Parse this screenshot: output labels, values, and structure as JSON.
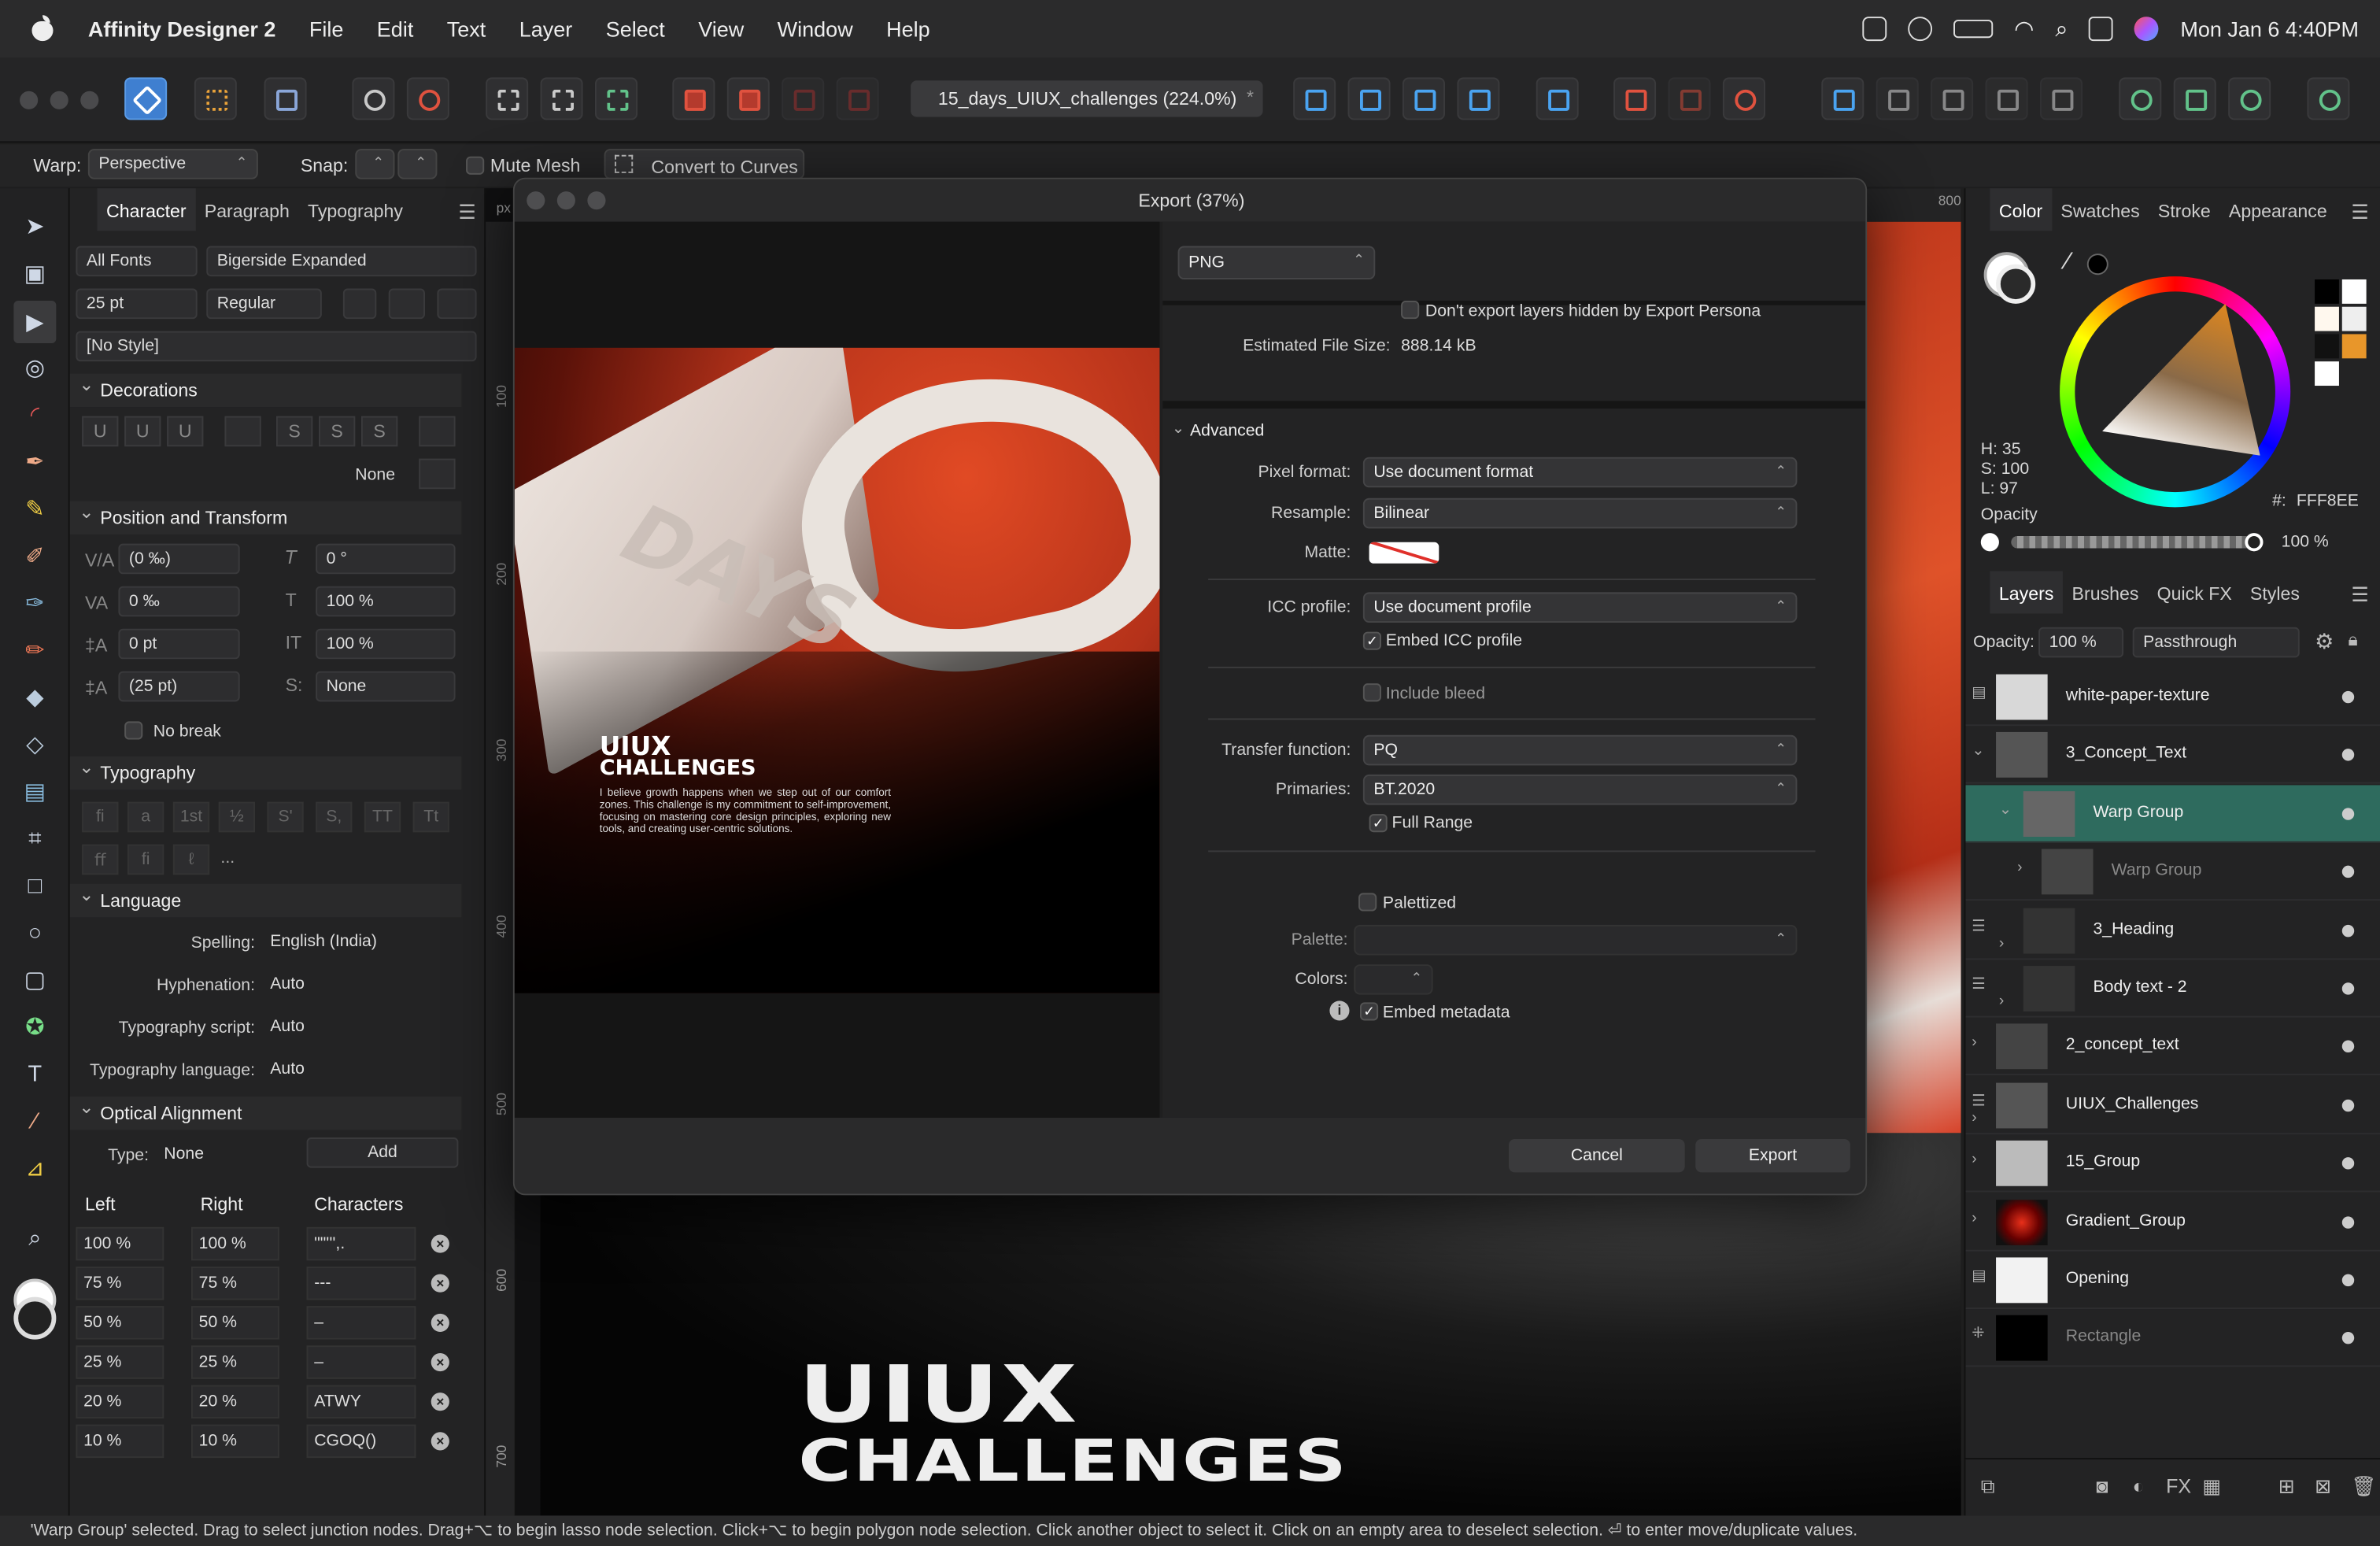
{
  "menubar": {
    "app_name": "Affinity Designer 2",
    "items": [
      "File",
      "Edit",
      "Text",
      "Layer",
      "Select",
      "View",
      "Window",
      "Help"
    ],
    "datetime": "Mon Jan 6  4:40PM"
  },
  "toolbar": {
    "doc_tab": "15_days_UIUX_challenges  (224.0%)",
    "doc_tab_star": "*"
  },
  "context": {
    "warp_label": "Warp:",
    "warp_value": "Perspective",
    "snap_label": "Snap:",
    "mute_mesh": "Mute Mesh",
    "convert": "Convert to Curves"
  },
  "character": {
    "tabs": [
      "Character",
      "Paragraph",
      "Typography"
    ],
    "font_collection": "All Fonts",
    "font_family": "Bigerside Expanded",
    "font_size": "25 pt",
    "font_weight": "Regular",
    "style": "[No Style]",
    "decorations_title": "Decorations",
    "deco_none": "None",
    "pos_title": "Position and Transform",
    "tracking": "(0 ‰)",
    "shear": "0 °",
    "kerning": "0 ‰",
    "hscale": "100 %",
    "baseline": "0 pt",
    "vscale": "100 %",
    "leading": "(25 pt)",
    "shift": "None",
    "nobreak": "No break",
    "typography_title": "Typography",
    "typo_buttons": [
      "fi",
      "a",
      "1st",
      "½",
      "S'",
      "S,",
      "TT",
      "Tt",
      "ﬀ",
      "fi",
      "ℓ",
      "..."
    ],
    "language_title": "Language",
    "spelling_label": "Spelling:",
    "spelling": "English (India)",
    "hyph_label": "Hyphenation:",
    "hyph": "Auto",
    "script_label": "Typography script:",
    "script": "Auto",
    "lang_label": "Typography language:",
    "lang": "Auto",
    "optical_title": "Optical Alignment",
    "type_label": "Type:",
    "type_value": "None",
    "add": "Add",
    "opt_headers": [
      "Left",
      "Right",
      "Characters"
    ],
    "opt_rows": [
      {
        "left": "100 %",
        "right": "100 %",
        "chars": "\"\"''',."
      },
      {
        "left": "75 %",
        "right": "75 %",
        "chars": "---"
      },
      {
        "left": "50 %",
        "right": "50 %",
        "chars": "–"
      },
      {
        "left": "25 %",
        "right": "25 %",
        "chars": "–"
      },
      {
        "left": "20 %",
        "right": "20 %",
        "chars": "ATWY"
      },
      {
        "left": "10 %",
        "right": "10 %",
        "chars": "CGOQ()"
      }
    ]
  },
  "ruler": {
    "v": [
      "100",
      "200",
      "300",
      "400",
      "500",
      "600",
      "700"
    ],
    "h": "800",
    "px": "px"
  },
  "canvas": {
    "big_line1": "UIUX",
    "big_line2": "CHALLENGES"
  },
  "dialog": {
    "title": "Export (37%)",
    "format": "PNG",
    "hidden_layers": "Don't export layers hidden by Export Persona",
    "filesize_label": "Estimated File Size:",
    "filesize": "888.14 kB",
    "advanced": "Advanced",
    "pixel_label": "Pixel format:",
    "pixel": "Use document format",
    "resample_label": "Resample:",
    "resample": "Bilinear",
    "matte_label": "Matte:",
    "icc_label": "ICC profile:",
    "icc": "Use document profile",
    "embed_icc": "Embed ICC profile",
    "bleed": "Include bleed",
    "transfer_label": "Transfer function:",
    "transfer": "PQ",
    "primaries_label": "Primaries:",
    "primaries": "BT.2020",
    "full_range": "Full Range",
    "palettized": "Palettized",
    "palette_label": "Palette:",
    "colors_label": "Colors:",
    "embed_meta": "Embed metadata",
    "cancel": "Cancel",
    "export": "Export"
  },
  "preview": {
    "line1": "UIUX",
    "line2": "CHALLENGES",
    "days": "DAYS",
    "body": "I believe growth happens when we step out of our comfort zones. This challenge is my commitment to self-improvement, focusing on mastering core design principles, exploring new tools, and creating user-centric solutions."
  },
  "color": {
    "tabs": [
      "Color",
      "Swatches",
      "Stroke",
      "Appearance"
    ],
    "h": "H: 35",
    "s": "S: 100",
    "l": "L: 97",
    "hex_label": "#:",
    "hex": "FFF8EE",
    "opacity_label": "Opacity",
    "opacity": "100 %"
  },
  "layers": {
    "tabs": [
      "Layers",
      "Brushes",
      "Quick FX",
      "Styles"
    ],
    "opacity_label": "Opacity:",
    "opacity": "100 %",
    "blend": "Passthrough",
    "items": [
      {
        "name": "white-paper-texture"
      },
      {
        "name": "3_Concept_Text"
      },
      {
        "name": "Warp Group"
      },
      {
        "name": "Warp Group"
      },
      {
        "name": "3_Heading"
      },
      {
        "name": "Body text - 2"
      },
      {
        "name": "2_concept_text"
      },
      {
        "name": "UIUX_Challenges"
      },
      {
        "name": "15_Group"
      },
      {
        "name": "Gradient_Group"
      },
      {
        "name": "Opening"
      },
      {
        "name": "Rectangle"
      }
    ]
  },
  "status": {
    "text": "'Warp Group' selected. Drag to select junction nodes. Drag+⌥ to begin lasso node selection. Click+⌥ to begin polygon node selection. Click another object to select it. Click on an empty area to deselect selection. ⏎ to enter move/duplicate values."
  },
  "colors": {
    "accent": "#2e6b5e",
    "red": "#d5401f"
  }
}
